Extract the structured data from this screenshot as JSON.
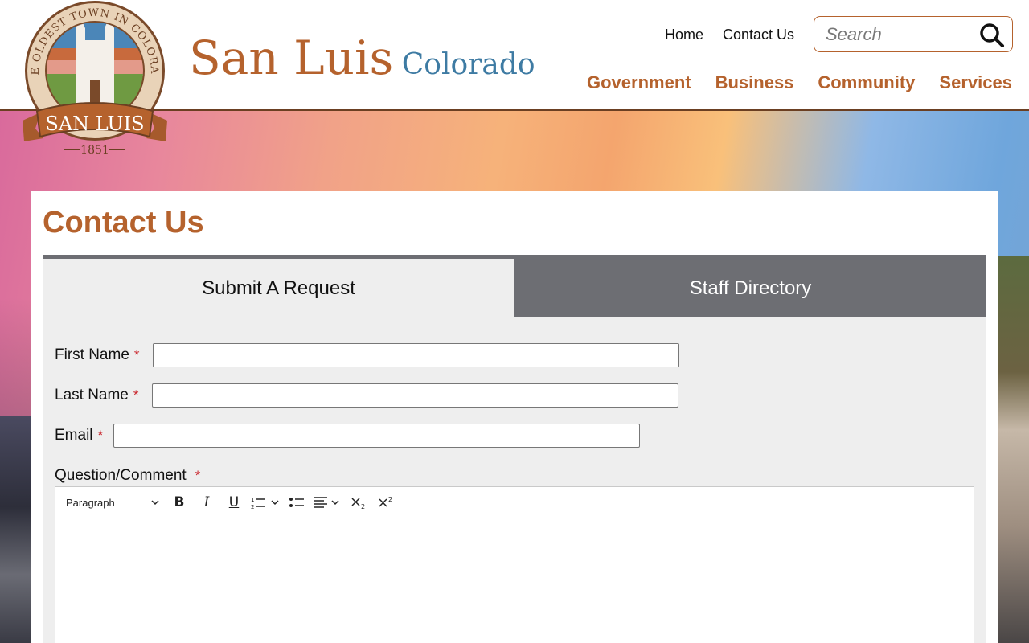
{
  "site": {
    "name": "San Luis",
    "state": "Colorado",
    "logo": {
      "arc_text": "THE OLDEST TOWN IN COLORADO",
      "banner_text": "SAN LUIS",
      "year": "1851"
    }
  },
  "utility_nav": {
    "home": "Home",
    "contact": "Contact Us"
  },
  "search": {
    "placeholder": "Search"
  },
  "main_nav": [
    "Government",
    "Business",
    "Community",
    "Services"
  ],
  "page": {
    "title": "Contact Us"
  },
  "tabs": {
    "active": "Submit A Request",
    "inactive": "Staff Directory"
  },
  "form": {
    "first_name_label": "First Name",
    "last_name_label": "Last Name",
    "email_label": "Email",
    "comment_label": "Question/Comment",
    "required_mark": "*",
    "first_name_value": "",
    "last_name_value": "",
    "email_value": ""
  },
  "editor": {
    "block_format": "Paragraph"
  },
  "colors": {
    "brand_rust": "#b5622d",
    "brand_blue": "#3e7ba3",
    "tab_gray": "#6d6e73",
    "required_red": "#c9252c"
  }
}
